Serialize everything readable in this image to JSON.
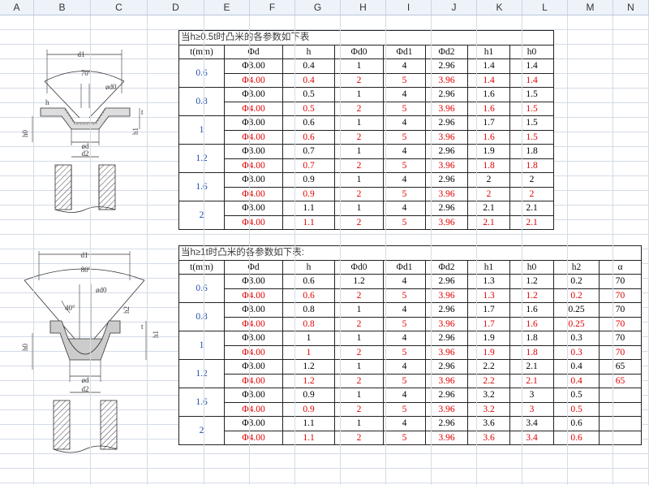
{
  "columns": [
    "A",
    "B",
    "C",
    "D",
    "E",
    "F",
    "G",
    "H",
    "I",
    "J",
    "K",
    "L",
    "M",
    "N"
  ],
  "table1": {
    "title": "当h≥0.5t时凸米的各参数如下表",
    "headers": [
      "t(mm)",
      "Φd",
      "h",
      "Φd0",
      "Φd1",
      "Φd2",
      "h1",
      "h0"
    ],
    "groups": [
      {
        "t": "0.6",
        "rows": [
          [
            "Φ3.00",
            "0.4",
            "1",
            "4",
            "2.96",
            "1.4",
            "1.4"
          ],
          [
            "Φ4.00",
            "0.4",
            "2",
            "5",
            "3.96",
            "1.4",
            "1.4"
          ]
        ]
      },
      {
        "t": "0.8",
        "rows": [
          [
            "Φ3.00",
            "0.5",
            "1",
            "4",
            "2.96",
            "1.6",
            "1.5"
          ],
          [
            "Φ4.00",
            "0.5",
            "2",
            "5",
            "3.96",
            "1.6",
            "1.5"
          ]
        ]
      },
      {
        "t": "1",
        "rows": [
          [
            "Φ3.00",
            "0.6",
            "1",
            "4",
            "2.96",
            "1.7",
            "1.5"
          ],
          [
            "Φ4.00",
            "0.6",
            "2",
            "5",
            "3.96",
            "1.6",
            "1.5"
          ]
        ]
      },
      {
        "t": "1.2",
        "rows": [
          [
            "Φ3.00",
            "0.7",
            "1",
            "4",
            "2.96",
            "1.9",
            "1.8"
          ],
          [
            "Φ4.00",
            "0.7",
            "2",
            "5",
            "3.96",
            "1.8",
            "1.8"
          ]
        ]
      },
      {
        "t": "1.6",
        "rows": [
          [
            "Φ3.00",
            "0.9",
            "1",
            "4",
            "2.96",
            "2",
            "2"
          ],
          [
            "Φ4.00",
            "0.9",
            "2",
            "5",
            "3.96",
            "2",
            "2"
          ]
        ]
      },
      {
        "t": "2",
        "rows": [
          [
            "Φ3.00",
            "1.1",
            "1",
            "4",
            "2.96",
            "2.1",
            "2.1"
          ],
          [
            "Φ4.00",
            "1.1",
            "2",
            "5",
            "3.96",
            "2.1",
            "2.1"
          ]
        ]
      }
    ]
  },
  "table2": {
    "title": "当h≥1t时凸米的各参数如下表:",
    "headers": [
      "t(mm)",
      "Φd",
      "h",
      "Φd0",
      "Φd1",
      "Φd2",
      "h1",
      "h0",
      "h2",
      "α"
    ],
    "groups": [
      {
        "t": "0.6",
        "rows": [
          [
            "Φ3.00",
            "0.6",
            "1.2",
            "4",
            "2.96",
            "1.3",
            "1.2",
            "0.2",
            "70"
          ],
          [
            "Φ4.00",
            "0.6",
            "2",
            "5",
            "3.96",
            "1.3",
            "1.2",
            "0.2",
            "70"
          ]
        ]
      },
      {
        "t": "0.8",
        "rows": [
          [
            "Φ3.00",
            "0.8",
            "1",
            "4",
            "2.96",
            "1.7",
            "1.6",
            "0.25",
            "70"
          ],
          [
            "Φ4.00",
            "0.8",
            "2",
            "5",
            "3.96",
            "1.7",
            "1.6",
            "0.25",
            "70"
          ]
        ]
      },
      {
        "t": "1",
        "rows": [
          [
            "Φ3.00",
            "1",
            "1",
            "4",
            "2.96",
            "1.9",
            "1.8",
            "0.3",
            "70"
          ],
          [
            "Φ4.00",
            "1",
            "2",
            "5",
            "3.96",
            "1.9",
            "1.8",
            "0.3",
            "70"
          ]
        ]
      },
      {
        "t": "1.2",
        "rows": [
          [
            "Φ3.00",
            "1.2",
            "1",
            "4",
            "2.96",
            "2.2",
            "2.1",
            "0.4",
            "65"
          ],
          [
            "Φ4.00",
            "1.2",
            "2",
            "5",
            "3.96",
            "2.2",
            "2.1",
            "0.4",
            "65"
          ]
        ]
      },
      {
        "t": "1.6",
        "rows": [
          [
            "Φ3.00",
            "0.9",
            "1",
            "4",
            "2.96",
            "3.2",
            "3",
            "0.5",
            ""
          ],
          [
            "Φ4.00",
            "0.9",
            "2",
            "5",
            "3.96",
            "3.2",
            "3",
            "0.5",
            ""
          ]
        ]
      },
      {
        "t": "2",
        "rows": [
          [
            "Φ3.00",
            "1.1",
            "1",
            "4",
            "2.96",
            "3.6",
            "3.4",
            "0.6",
            ""
          ],
          [
            "Φ4.00",
            "1.1",
            "2",
            "5",
            "3.96",
            "3.6",
            "3.4",
            "0.6",
            ""
          ]
        ]
      }
    ]
  },
  "drawing1": {
    "d1": "d1",
    "angle": "70°",
    "d0": "ød0",
    "h": "h",
    "t": "t",
    "h1": "h1",
    "h0": "h0",
    "d": "ød",
    "d2": "d2"
  },
  "drawing2": {
    "d1": "d1",
    "angle": "80°",
    "d0": "ød0",
    "angle2": "40°",
    "h2": "h2",
    "t": "t",
    "h1": "h1",
    "h0": "h0",
    "d": "ød",
    "d2": "d2"
  }
}
